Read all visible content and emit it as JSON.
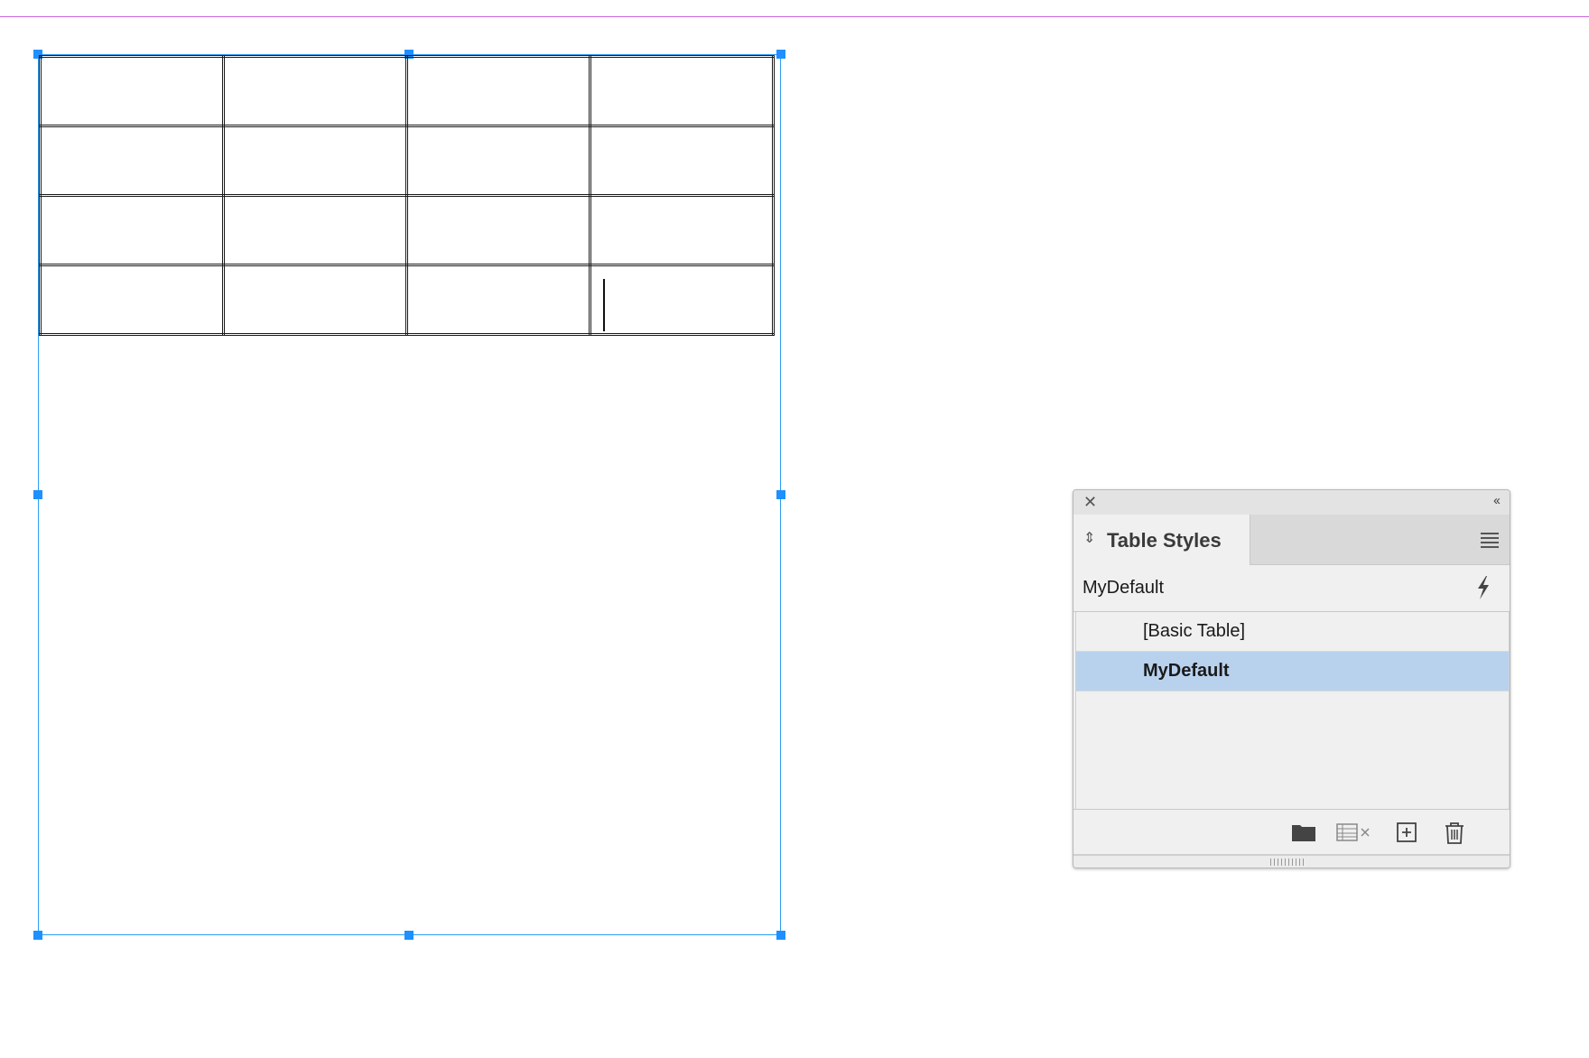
{
  "panel": {
    "tab_label": "Table Styles",
    "current_style": "MyDefault",
    "items": [
      {
        "label": "[Basic Table]",
        "selected": false
      },
      {
        "label": "MyDefault",
        "selected": true
      }
    ],
    "footer_icons": [
      "folder-icon",
      "clear-overrides-icon",
      "new-style-icon",
      "trash-icon"
    ],
    "selected_color": "#b8d2ee"
  },
  "document": {
    "table_rows": 4,
    "table_cols": 4,
    "frame_color": "#2a9df4",
    "guide_color": "#cc66dd"
  }
}
